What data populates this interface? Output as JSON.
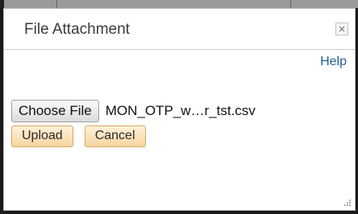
{
  "dialog": {
    "title": "File Attachment",
    "close_symbol": "×",
    "help_label": "Help"
  },
  "file_picker": {
    "choose_label": "Choose File",
    "selected_file": "MON_OTP_w…r_tst.csv"
  },
  "actions": {
    "upload_label": "Upload",
    "cancel_label": "Cancel"
  },
  "icons": {
    "close": "close-icon",
    "resize": "resize-grip-icon"
  },
  "colors": {
    "link": "#215e98",
    "button_fill": "#f7d59f",
    "button_border": "#d9a85f",
    "title_text": "#3a3a3a"
  }
}
